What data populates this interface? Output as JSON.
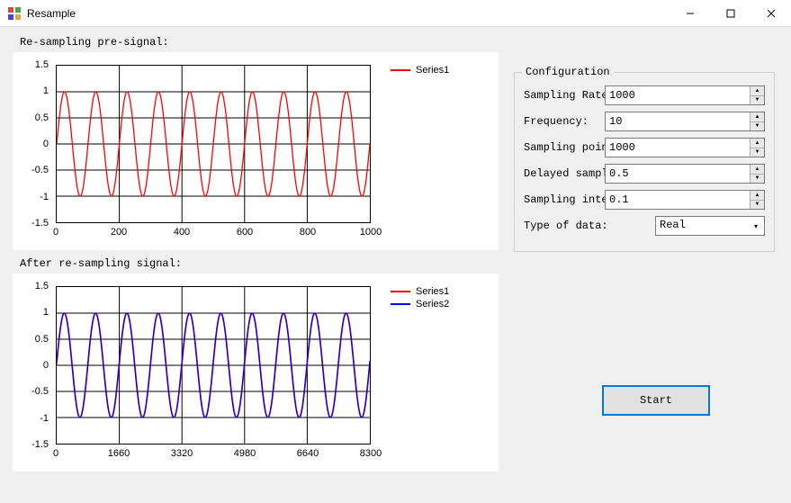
{
  "window": {
    "title": "Resample"
  },
  "labels": {
    "pre_signal": "Re-sampling pre-signal:",
    "after_signal": "After re-sampling signal:"
  },
  "config": {
    "title": "Configuration",
    "sampling_rate_label": "Sampling Rate:",
    "sampling_rate_value": "1000",
    "frequency_label": "Frequency:",
    "frequency_value": "10",
    "sampling_points_label": "Sampling points:",
    "sampling_points_value": "1000",
    "delayed_label": "Delayed sampling point",
    "delayed_value": "0.5",
    "interval_label": "Sampling interval:",
    "interval_value": "0.1",
    "type_label": "Type of data:",
    "type_value": "Real"
  },
  "buttons": {
    "start": "Start"
  },
  "legend": {
    "series1": "Series1",
    "series2": "Series2"
  },
  "colors": {
    "series1": "#ff0000",
    "series2": "#0000ff",
    "accent": "#0078d7"
  },
  "chart_data": [
    {
      "type": "line",
      "title": "Re-sampling pre-signal",
      "xlabel": "",
      "ylabel": "",
      "xlim": [
        0,
        1000
      ],
      "ylim": [
        -1.5,
        1.5
      ],
      "x_ticks": [
        0,
        200,
        400,
        600,
        800,
        1000
      ],
      "y_ticks": [
        -1.5,
        -1,
        -0.5,
        0,
        0.5,
        1,
        1.5
      ],
      "series": [
        {
          "name": "Series1",
          "color": "#ff0000",
          "function": "sin(2*pi*10*x/1000)",
          "amplitude": 1.0
        }
      ]
    },
    {
      "type": "line",
      "title": "After re-sampling signal",
      "xlabel": "",
      "ylabel": "",
      "xlim": [
        0,
        8300
      ],
      "ylim": [
        -1.5,
        1.5
      ],
      "x_ticks": [
        0,
        1660,
        3320,
        4980,
        6640,
        8300
      ],
      "y_ticks": [
        -1.5,
        -1,
        -0.5,
        0,
        0.5,
        1,
        1.5
      ],
      "series": [
        {
          "name": "Series1",
          "color": "#ff0000",
          "function": "sin(2*pi*0.001205*x)",
          "amplitude": 1.0
        },
        {
          "name": "Series2",
          "color": "#0000ff",
          "function": "sin(2*pi*0.001205*x + phase)",
          "amplitude": 1.0
        }
      ]
    }
  ]
}
